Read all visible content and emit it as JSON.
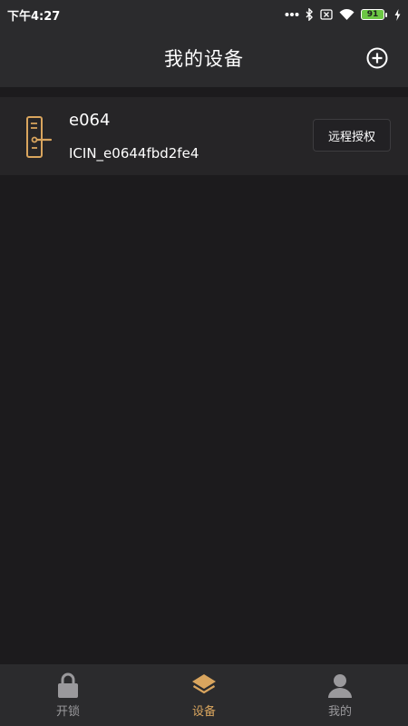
{
  "status_bar": {
    "time": "下午4:27",
    "battery": "91",
    "icons": [
      "more-dots-icon",
      "bluetooth-icon",
      "sim-x-icon",
      "wifi-icon",
      "battery-icon",
      "charging-icon"
    ]
  },
  "header": {
    "title": "我的设备",
    "add_icon": "plus-circle-icon"
  },
  "devices": [
    {
      "name": "e064",
      "id": "ICIN_e0644fbd2fe4",
      "action_label": "远程授权",
      "icon": "door-lock-icon"
    }
  ],
  "bottom_nav": {
    "items": [
      {
        "label": "开锁",
        "icon": "padlock-icon",
        "active": false
      },
      {
        "label": "设备",
        "icon": "layers-icon",
        "active": true
      },
      {
        "label": "我的",
        "icon": "user-icon",
        "active": false
      }
    ]
  },
  "colors": {
    "background": "#1c1b1d",
    "bar": "#2b2b2d",
    "card": "#262527",
    "accent": "#d9a55e",
    "inactive": "#9a999c"
  }
}
